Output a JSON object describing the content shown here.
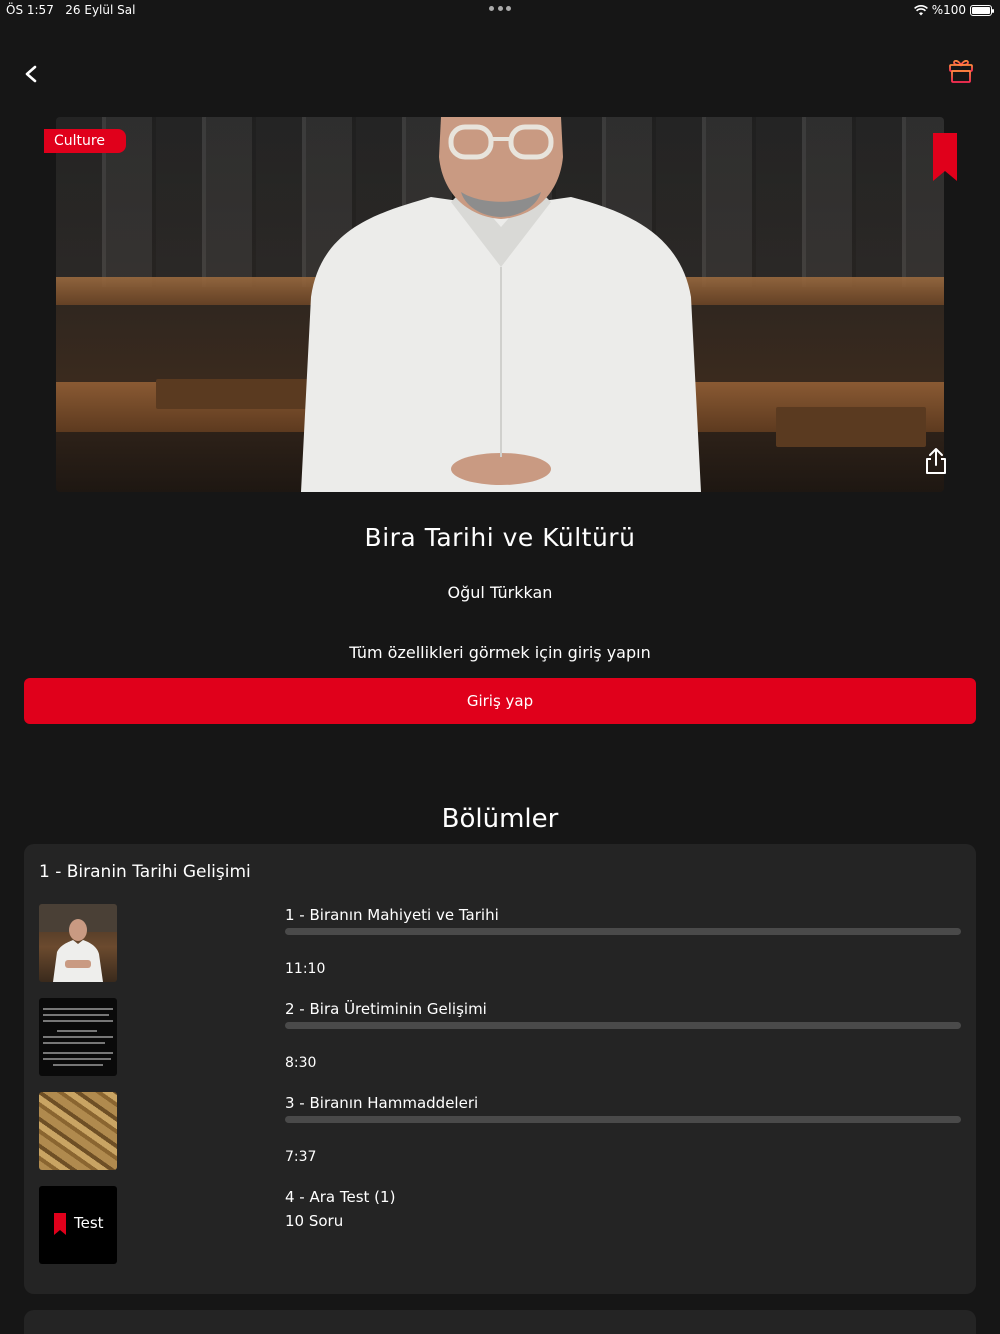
{
  "status_bar": {
    "time": "ÖS 1:57",
    "date": "26 Eylül Sal",
    "battery_pct": "%100"
  },
  "hero": {
    "category_tag": "Culture"
  },
  "course": {
    "title": "Bira Tarihi ve Kültürü",
    "instructor": "Oğul Türkkan",
    "login_hint": "Tüm özellikleri görmek için giriş yapın",
    "login_button": "Giriş yap"
  },
  "sections_heading": "Bölümler",
  "chapters": [
    {
      "title": "1 - Biranin Tarihi Gelişimi",
      "lessons": [
        {
          "name": "1 - Biranın Mahiyeti ve Tarihi",
          "duration": "11:10",
          "progress": 0
        },
        {
          "name": "2 - Bira Üretiminin Gelişimi",
          "duration": "8:30",
          "progress": 0
        },
        {
          "name": "3 - Biranın Hammaddeleri",
          "duration": "7:37",
          "progress": 0
        },
        {
          "name": "4 - Ara Test (1)",
          "question_count": "10 Soru",
          "thumb_label": "Test"
        }
      ]
    }
  ],
  "colors": {
    "accent": "#e0001b",
    "background": "#161616",
    "card": "#242424",
    "progress_track": "#4a4a4a"
  },
  "icons": {
    "back": "chevron-left-icon",
    "gift": "gift-icon",
    "bookmark": "bookmark-icon",
    "share": "share-icon",
    "wifi": "wifi-icon",
    "battery": "battery-icon"
  }
}
